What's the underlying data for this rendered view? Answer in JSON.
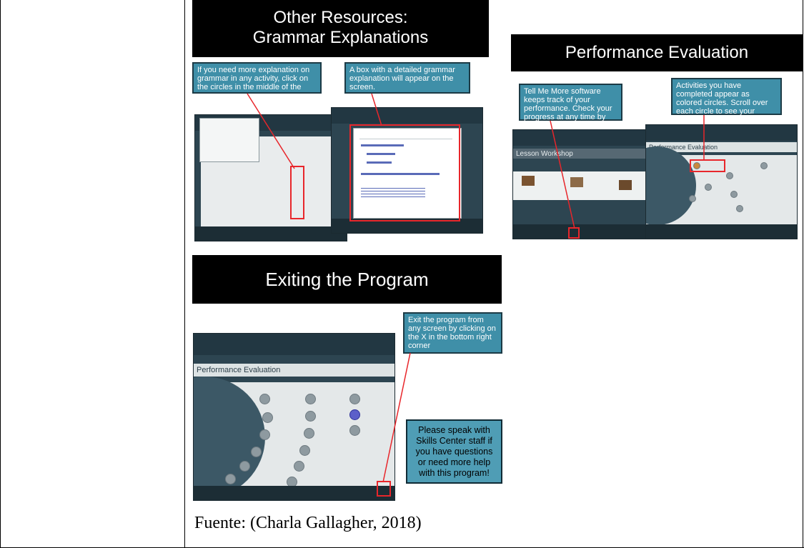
{
  "slides": {
    "grammar": {
      "title_line1": "Other Resources:",
      "title_line2": "Grammar Explanations",
      "callout_left": "If you need more explanation on grammar in any activity, click on the circles in the middle of the screen.",
      "callout_right": "A box with a detailed grammar explanation will appear on the screen."
    },
    "performance": {
      "title": "Performance Evaluation",
      "callout_left": "Tell Me More software keeps track of your performance. Check your progress at any time by clicking this button.",
      "callout_right": "Activities you have completed appear as colored circles. Scroll over each circle to see your score.",
      "screen_left_band": "Lesson Workshop",
      "screen_right_band": "Performance Evaluation"
    },
    "exiting": {
      "title": "Exiting the Program",
      "callout_top": "Exit the program from any screen by clicking on the X in the bottom right corner",
      "callout_bottom": "Please speak with Skills Center staff if you have questions or need more help with this program!",
      "screen_band": "Performance Evaluation"
    }
  },
  "caption": "Fuente: (Charla Gallagher, 2018)"
}
